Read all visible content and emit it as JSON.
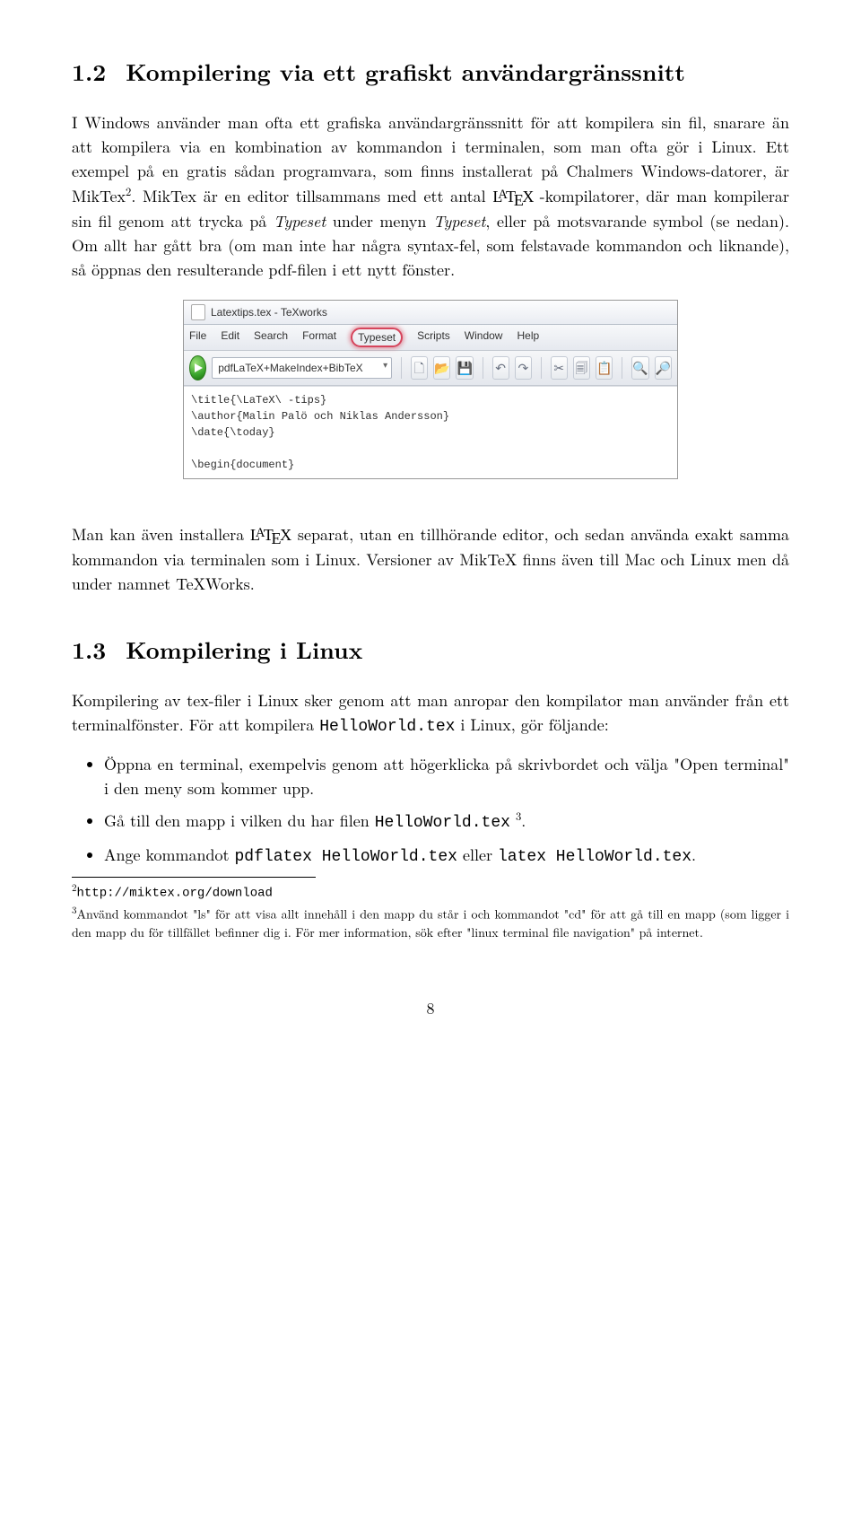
{
  "section12": {
    "number": "1.2",
    "title": "Kompilering via ett grafiskt användargränssnitt",
    "p1a": "I Windows använder man ofta ett grafiska användargränssnitt för att kompilera sin fil, snarare än att kompilera via en kombination av kommandon i terminalen, som man ofta gör i Linux. Ett exempel på en gratis sådan programvara, som finns installerat på Chalmers Windows-datorer, är MikTex",
    "p1b": ". MikTex är en editor tillsammans med ett antal ",
    "p1c": "-kompilatorer, där man kompilerar sin fil genom att trycka på ",
    "typeset1": "Typeset",
    "p1d": " under menyn ",
    "typeset2": "Typeset",
    "p1e": ", eller på motsvarande symbol (se nedan). Om allt har gått bra (om man inte har några syntax-fel, som felstavade kommandon och liknande), så öppnas den resulterande pdf-filen i ett nytt fönster.",
    "p2a": "Man kan även installera ",
    "p2b": " separat, utan en tillhörande editor, och sedan använda exakt samma kommandon via terminalen som i Linux. Versioner av MikTeX finns även till Mac och Linux men då under namnet TeXWorks."
  },
  "screenshot": {
    "title": "Latextips.tex - TeXworks",
    "menu": [
      "File",
      "Edit",
      "Search",
      "Format",
      "Typeset",
      "Scripts",
      "Window",
      "Help"
    ],
    "combo": "pdfLaTeX+MakeIndex+BibTeX",
    "editor": "\\title{\\LaTeX\\ -tips}\n\\author{Malin Palö och Niklas Andersson}\n\\date{\\today}\n\n\\begin{document}"
  },
  "section13": {
    "number": "1.3",
    "title": "Kompilering i Linux",
    "p1a": "Kompilering av tex-filer i Linux sker genom att man anropar den kompilator man använder från ett terminalfönster. För att kompilera ",
    "code1": "HelloWorld.tex",
    "p1b": " i Linux, gör följande:",
    "b1": "Öppna en terminal, exempelvis genom att högerklicka på skrivbordet och välja \"Open terminal\" i den meny som kommer upp.",
    "b2a": "Gå till den mapp i vilken du har filen ",
    "b2code": "HelloWorld.tex",
    "b2b": " ",
    "b2c": ".",
    "b3a": "Ange kommandot ",
    "b3code1": "pdflatex HelloWorld.tex",
    "b3b": " eller ",
    "b3code2": "latex HelloWorld.tex",
    "b3c": "."
  },
  "footnotes": {
    "f2": "http://miktex.org/download",
    "f3": "Använd kommandot \"ls\" för att visa allt innehåll i den mapp du står i och kommandot \"cd\" för att gå till en mapp (som ligger i den mapp du för tillfället befinner dig i. För mer information, sök efter \"linux terminal file navigation\" på internet."
  },
  "pagenum": "8"
}
